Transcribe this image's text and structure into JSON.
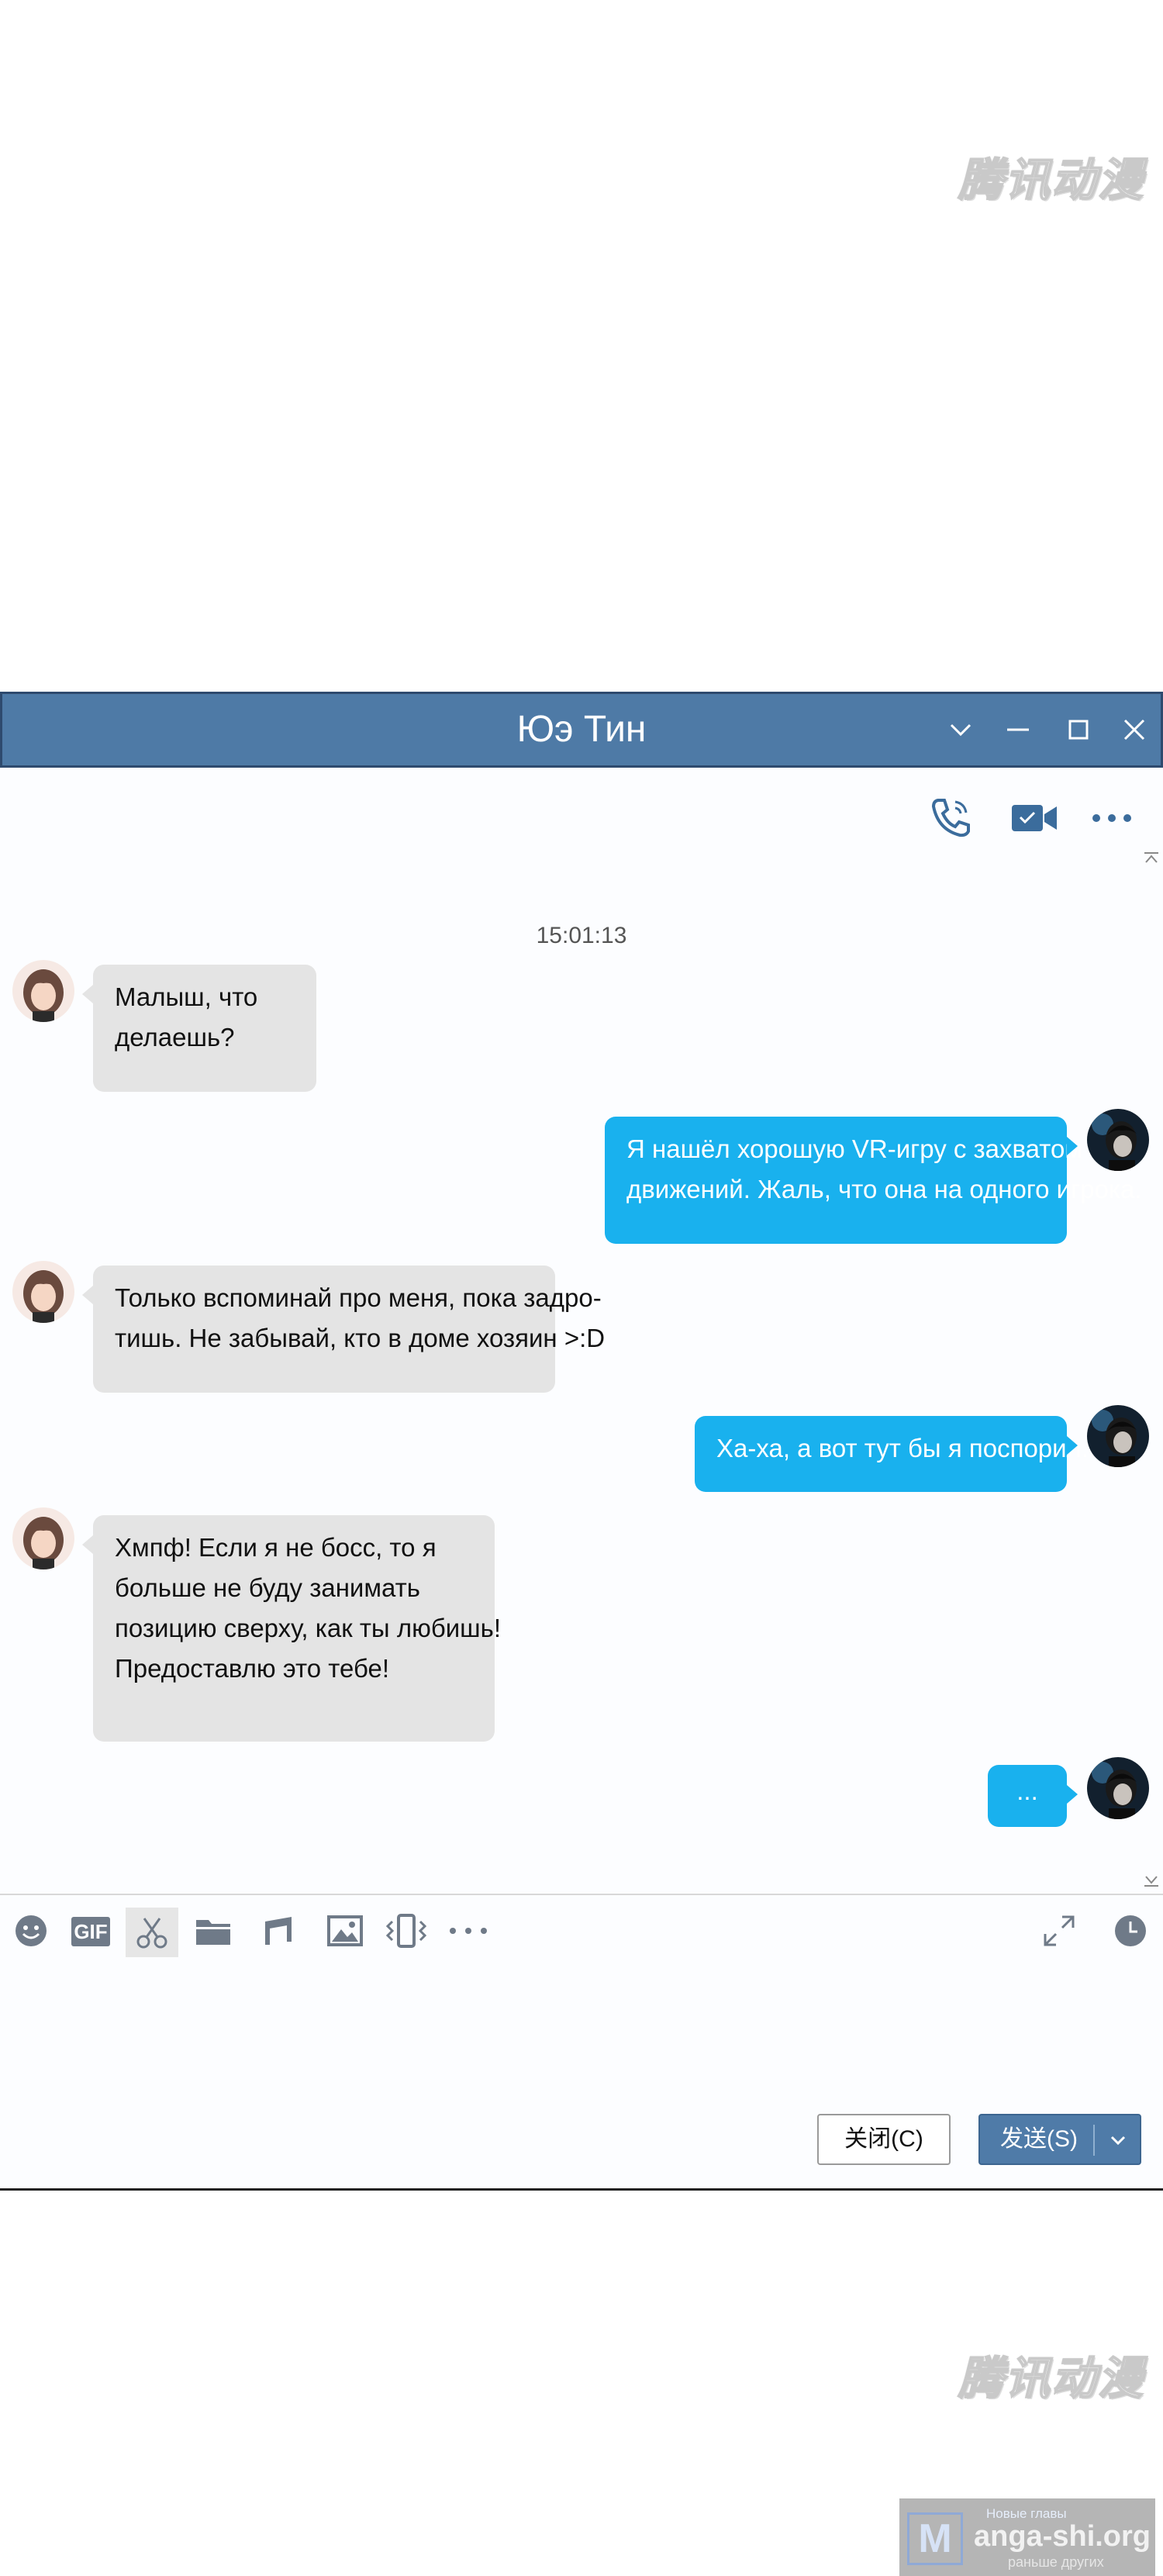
{
  "watermark": "腾讯动漫",
  "window": {
    "title": "Юэ Тин",
    "controls": [
      "chevron-down-icon",
      "minimize-icon",
      "maximize-icon",
      "close-icon"
    ]
  },
  "chat": {
    "timestamp": "15:01:13",
    "messages": [
      {
        "from": "her",
        "lines": [
          "Малыш, что",
          "делаешь?"
        ]
      },
      {
        "from": "me",
        "lines": [
          "Я нашёл хорошую VR-игру с захватом",
          "движений. Жаль, что она на одного игрока."
        ]
      },
      {
        "from": "her",
        "lines": [
          "Только вспоминай про меня, пока задро-",
          "тишь. Не забывай, кто в доме хозяин >:D"
        ]
      },
      {
        "from": "me",
        "lines": [
          "Ха-ха, а вот тут бы я поспорил."
        ]
      },
      {
        "from": "her",
        "lines": [
          "Хмпф! Если я не босс, то я",
          "больше не буду занимать",
          "позицию сверху, как ты любишь!",
          "Предоставлю это тебе!"
        ]
      },
      {
        "from": "me",
        "lines": [
          "..."
        ]
      }
    ]
  },
  "input_toolbar": {
    "gif_label": "GIF"
  },
  "buttons": {
    "close_label": "关闭(C)",
    "send_label": "发送(S)"
  },
  "ad": {
    "letter": "M",
    "top": "Новые главы",
    "site": "anga-shi.org",
    "bottom": "раньше других"
  },
  "colors": {
    "titlebar": "#4e7aa6",
    "outgoing_bubble": "#19b1ee",
    "incoming_bubble": "#e4e4e4",
    "send_button": "#4f7ba8"
  }
}
